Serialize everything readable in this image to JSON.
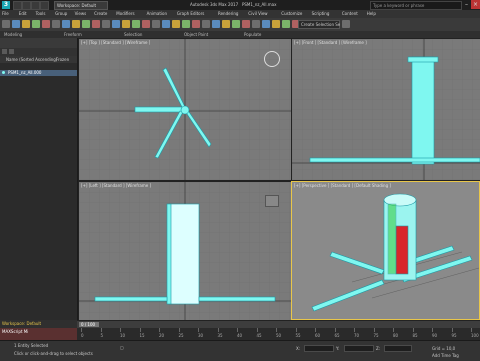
{
  "app": {
    "title": "Autodesk 3ds Max 2017",
    "filename": "PSM1_nz_All.max",
    "workspace_label": "Workspace: Default",
    "search_placeholder": "Type a keyword or phrase",
    "logo": "3"
  },
  "menu": [
    "File",
    "Edit",
    "Tools",
    "Group",
    "Views",
    "Create",
    "Modifiers",
    "Animation",
    "Graph Editors",
    "Rendering",
    "Civil View",
    "Customize",
    "Scripting",
    "Content",
    "Help"
  ],
  "toolbar": {
    "selection_set_label": "Create Selection Se",
    "icons": [
      "undo-icon",
      "redo-icon",
      "link-icon",
      "unlink-icon",
      "bind-icon",
      "select-filter-icon",
      "select-icon",
      "select-by-name-icon",
      "rect-select-icon",
      "window-crossing-icon",
      "move-icon",
      "rotate-icon",
      "scale-icon",
      "placement-icon",
      "ref-coord-icon",
      "pivot-icon",
      "snap-icon",
      "angle-snap-icon",
      "percent-snap-icon",
      "spinner-snap-icon",
      "named-sel-icon",
      "mirror-icon",
      "align-icon",
      "layer-icon",
      "toggle-ribbon-icon",
      "curve-editor-icon",
      "schematic-icon",
      "material-editor-icon",
      "render-setup-icon",
      "rendered-frame-icon",
      "render-icon"
    ]
  },
  "ribbon": [
    "Modeling",
    "Freeform",
    "Selection",
    "Object Paint",
    "Populate"
  ],
  "scene_explorer": {
    "tabs": [
      "Select",
      "Display",
      "Edit",
      "Customize"
    ],
    "header": "Name (Sorted Ascending)",
    "header_right": "Frozen",
    "items": [
      {
        "label": "PSM1_nz_All.000",
        "selected": true
      }
    ]
  },
  "viewports": [
    {
      "label": "[+] [Top ] [Standard ] [Wireframe ]"
    },
    {
      "label": "[+] [Front ] [Standard ] [Wireframe ]"
    },
    {
      "label": "[+] [Left ] [Standard ] [Wireframe ]"
    },
    {
      "label": "[+] [Perspective ] [Standard ] [Default Shading ]"
    }
  ],
  "timeline": {
    "frame_display": "0 / 100",
    "ticks": [
      "0",
      "5",
      "10",
      "15",
      "20",
      "25",
      "30",
      "35",
      "40",
      "45",
      "50",
      "55",
      "60",
      "65",
      "70",
      "75",
      "80",
      "85",
      "90",
      "95",
      "100"
    ]
  },
  "status": {
    "maxscript_label": "MAXScript Mi",
    "workspace_short": "Workspace: Default",
    "selection_text": "1 Entity Selected",
    "prompt_text": "Click or click-and-drag to select objects",
    "x_label": "X:",
    "y_label": "Y:",
    "z_label": "Z:",
    "grid_label": "Grid = 10,0",
    "add_time_tag": "Add Time Tag"
  },
  "colors": {
    "accent": "#1aa7b4",
    "wire": "#7ff7f0",
    "viewport_bg": "#7a7a7a",
    "active_border": "#e8c64a"
  }
}
